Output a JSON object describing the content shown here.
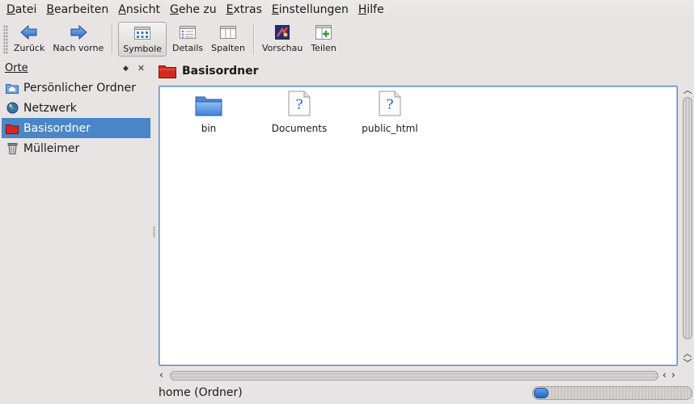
{
  "menu": [
    {
      "label": "Datei",
      "mnemonic": "D",
      "rest": "atei"
    },
    {
      "label": "Bearbeiten",
      "mnemonic": "B",
      "rest": "earbeiten"
    },
    {
      "label": "Ansicht",
      "mnemonic": "A",
      "rest": "nsicht"
    },
    {
      "label": "Gehe zu",
      "mnemonic": "G",
      "rest": "ehe zu"
    },
    {
      "label": "Extras",
      "mnemonic": "E",
      "rest": "xtras"
    },
    {
      "label": "Einstellungen",
      "mnemonic": "E",
      "rest": "instellungen"
    },
    {
      "label": "Hilfe",
      "mnemonic": "H",
      "rest": "ilfe"
    }
  ],
  "toolbar": {
    "back_label": "Zurück",
    "forward_label": "Nach vorne",
    "icons_label": "Symbole",
    "details_label": "Details",
    "columns_label": "Spalten",
    "preview_label": "Vorschau",
    "split_label": "Teilen",
    "active_view": "Symbole"
  },
  "sidebar": {
    "title": "Orte",
    "items": [
      {
        "label": "Persönlicher Ordner",
        "icon": "home-folder-icon",
        "selected": false
      },
      {
        "label": "Netzwerk",
        "icon": "network-globe-icon",
        "selected": false
      },
      {
        "label": "Basisordner",
        "icon": "root-folder-icon",
        "selected": true
      },
      {
        "label": "Mülleimer",
        "icon": "trash-icon",
        "selected": false
      }
    ]
  },
  "location": {
    "title": "Basisordner",
    "icon": "root-folder-icon"
  },
  "files": [
    {
      "name": "bin",
      "icon": "folder-icon"
    },
    {
      "name": "Documents",
      "icon": "unknown-file-icon"
    },
    {
      "name": "public_html",
      "icon": "unknown-file-icon"
    }
  ],
  "status": {
    "text": "home (Ordner)"
  },
  "colors": {
    "selection": "#4a86c8",
    "view_border": "#5a8fcc",
    "folder_blue": "#5b9be0",
    "root_red": "#d42a1e"
  }
}
